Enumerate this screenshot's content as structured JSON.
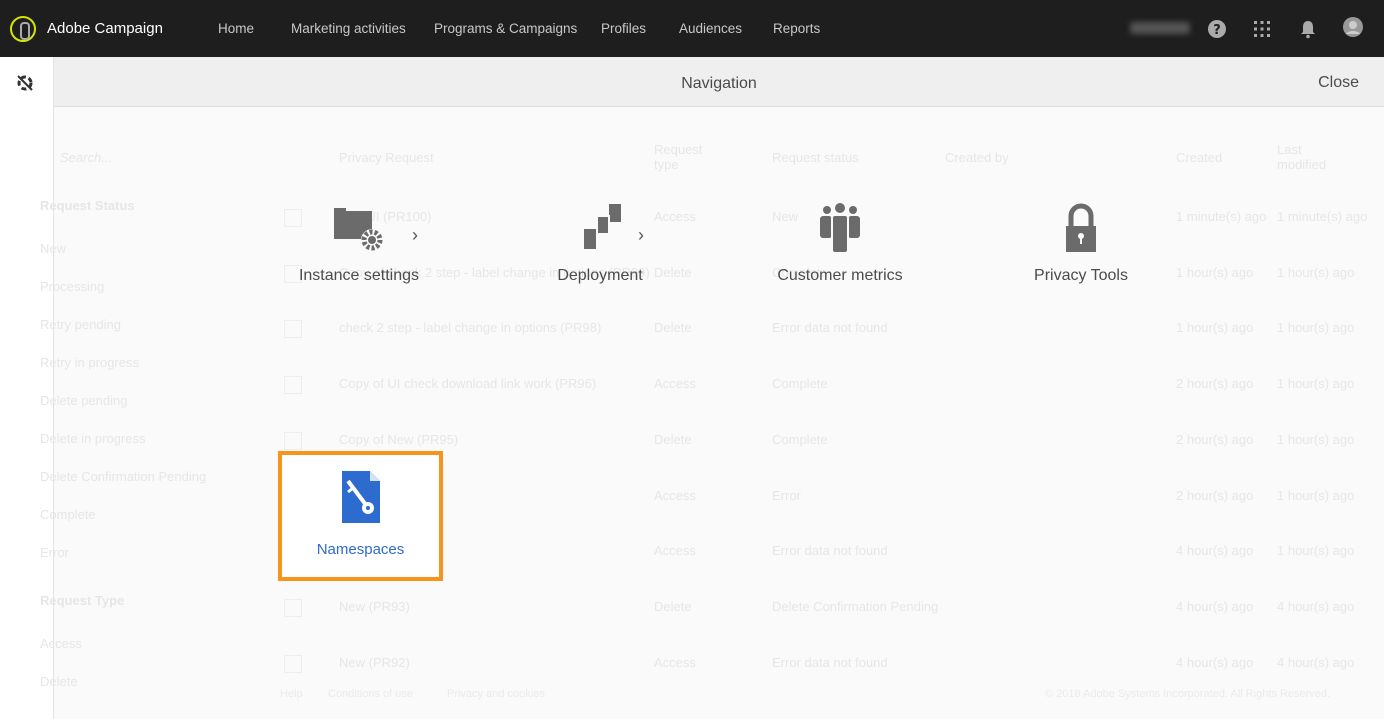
{
  "topbar": {
    "brand": "Adobe Campaign",
    "nav": [
      "Home",
      "Marketing activities",
      "Programs & Campaigns",
      "Profiles",
      "Audiences",
      "Reports"
    ]
  },
  "overlay": {
    "title": "Navigation",
    "close": "Close",
    "items": [
      {
        "label": "Instance settings",
        "icon": "folder-gear-icon",
        "has_submenu": true
      },
      {
        "label": "Deployment",
        "icon": "deployment-icon",
        "has_submenu": true
      },
      {
        "label": "Customer metrics",
        "icon": "people-icon",
        "has_submenu": false
      },
      {
        "label": "Privacy Tools",
        "icon": "lock-icon",
        "has_submenu": false
      },
      {
        "label": "Namespaces",
        "icon": "key-document-icon",
        "highlighted": true
      }
    ]
  },
  "background": {
    "search_placeholder": "Search...",
    "filters": {
      "status_heading": "Request Status",
      "status": [
        "New",
        "Processing",
        "Retry pending",
        "Retry in progress",
        "Delete pending",
        "Delete in progress",
        "Delete Confirmation Pending",
        "Complete",
        "Error"
      ],
      "type_heading": "Request Type",
      "type": [
        "Access",
        "Delete"
      ]
    },
    "columns": [
      "Privacy Request",
      "Request type",
      "Request status",
      "Created by",
      "Created",
      "Last modified"
    ],
    "rows": [
      [
        "Test UI (PR100)",
        "Access",
        "New",
        "1 minute(s) ago",
        "1 minute(s) ago"
      ],
      [
        "Copy of check 2 step - label change in options (PR99)",
        "Delete",
        "Complete",
        "1 hour(s) ago",
        "1 hour(s) ago"
      ],
      [
        "check 2 step - label change in options (PR98)",
        "Delete",
        "Error data not found",
        "1 hour(s) ago",
        "1 hour(s) ago"
      ],
      [
        "Copy of UI check download link work (PR96)",
        "Access",
        "Complete",
        "2 hour(s) ago",
        "1 hour(s) ago"
      ],
      [
        "Copy of New (PR95)",
        "Delete",
        "Complete",
        "2 hour(s) ago",
        "1 hour(s) ago"
      ],
      [
        "UI (PR94)",
        "Access",
        "Error",
        "2 hour(s) ago",
        "1 hour(s) ago"
      ],
      [
        "(PR94)",
        "Access",
        "Error data not found",
        "4 hour(s) ago",
        "1 hour(s) ago"
      ],
      [
        "New (PR93)",
        "Delete",
        "Delete Confirmation Pending",
        "4 hour(s) ago",
        "4 hour(s) ago"
      ],
      [
        "New (PR92)",
        "Access",
        "Error data not found",
        "4 hour(s) ago",
        "4 hour(s) ago"
      ]
    ],
    "footer": {
      "links": [
        "Help",
        "Conditions of use",
        "Privacy and cookies"
      ],
      "copyright": "© 2018 Adobe Systems Incorporated. All Rights Reserved."
    }
  },
  "colors": {
    "highlight": "#f7941d",
    "link": "#2d6bcf",
    "topbar": "#1e1e1e"
  }
}
